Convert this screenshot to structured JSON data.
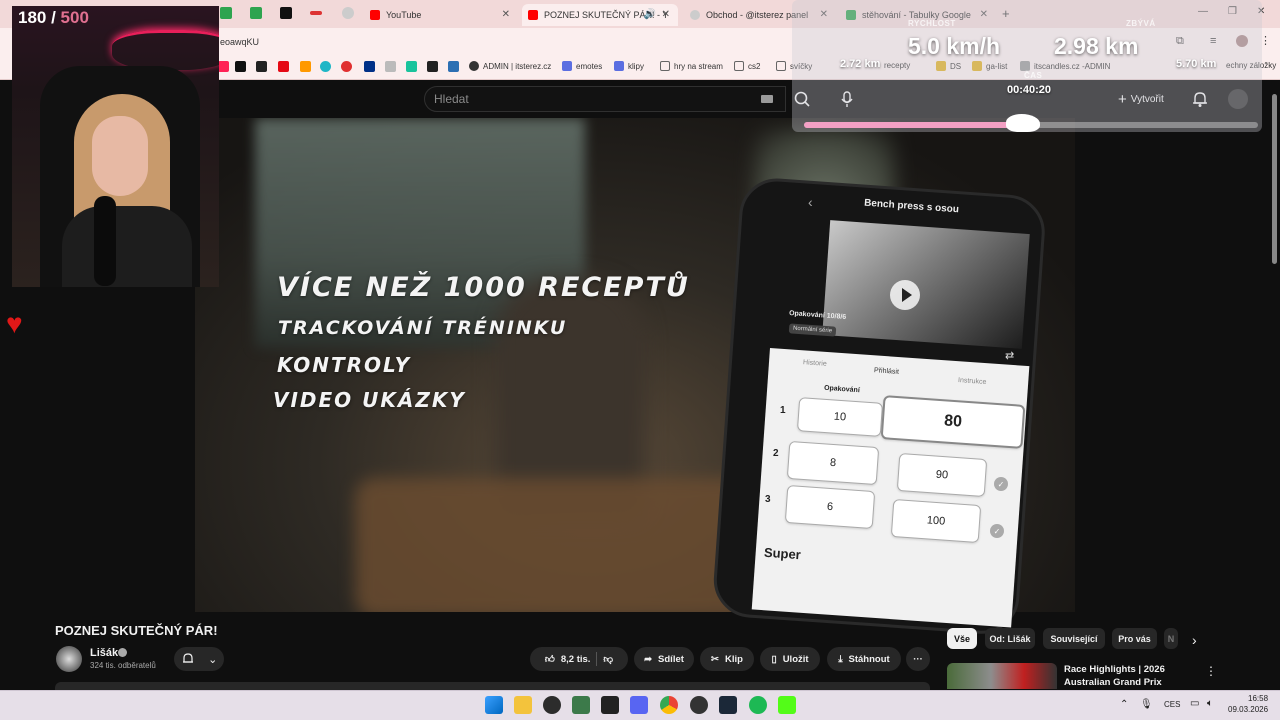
{
  "browser": {
    "tabs": [
      {
        "label": "YouTube",
        "active": false
      },
      {
        "label": "POZNEJ SKUTEČNÝ PÁR! - Y",
        "active": true
      },
      {
        "label": "Obchod - @itsterez panel",
        "active": false
      },
      {
        "label": "stěhování - Tabulky Google",
        "active": false
      }
    ],
    "new_tab": "+",
    "address": "eoawqKU",
    "bookmarks": [
      "ADMIN | itsterez.cz",
      "emotes",
      "klipy",
      "hry na stream",
      "cs2",
      "svíčky",
      "recepty",
      "DS",
      "ga-list",
      "itscandles.cz -ADMIN",
      "echny záložky"
    ]
  },
  "youtube": {
    "search_placeholder": "Hledat",
    "create_label": "Vytvořit",
    "video_title": "POZNEJ SKUTEČNÝ PÁR!",
    "channel": {
      "name": "Lišák",
      "subscribers": "324 tis. odběratelů"
    },
    "actions": {
      "likes": "8,2 tis.",
      "share": "Sdílet",
      "clip": "Klip",
      "save": "Uložit",
      "download": "Stáhnout"
    },
    "chips": [
      "Vše",
      "Od: Lišák",
      "Související",
      "Pro vás",
      "N"
    ],
    "recommended": {
      "title": "Race Highlights | 2026 Australian Grand Prix"
    }
  },
  "video_frame": {
    "lines": [
      "VÍCE NEŽ 1000 RECEPTŮ",
      "TRACKOVÁNÍ TRÉNINKU",
      "KONTROLY",
      "VIDEO UKÁZKY"
    ],
    "phone": {
      "title": "Bench press s osou",
      "sets_label": "Opakování 10/8/6",
      "series_label": "Normální série",
      "tabs": [
        "Historie",
        "Přihlásit",
        "Instrukce"
      ],
      "reps_header": "Opakování",
      "rows": [
        {
          "index": "1",
          "reps": "10",
          "weight": "80"
        },
        {
          "index": "2",
          "reps": "8",
          "weight": "90"
        },
        {
          "index": "3",
          "reps": "6",
          "weight": "100"
        }
      ],
      "note": "Super"
    }
  },
  "stream_overlay": {
    "counter": "180 /",
    "goal": "500",
    "speed_label": "RYCHLOST",
    "speed": "5.0 km/h",
    "distance": "2.98 km",
    "remaining_label": "ZBÝVÁ",
    "left_small": "2.72 km",
    "right_small": "5.70 km",
    "time_label": "ČAS",
    "time": "00:40:20",
    "progress_fraction": 0.48
  },
  "taskbar": {
    "lang": "CES",
    "time": "16:58",
    "date": "09.03.2026"
  },
  "colors": {
    "accent": "#ff0000",
    "youtube_bg": "#0f0f0f",
    "chrome": "#f2d9d9",
    "overlay_progress": "#f3a0c4"
  }
}
